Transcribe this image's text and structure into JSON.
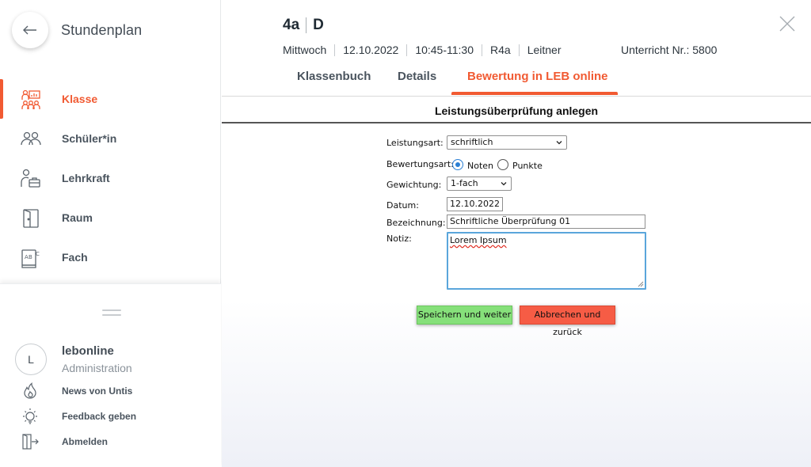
{
  "sidebar": {
    "title": "Stundenplan",
    "items": [
      {
        "label": "Klasse",
        "icon": "class-icon",
        "active": true
      },
      {
        "label": "Schüler*in",
        "icon": "students-icon",
        "active": false
      },
      {
        "label": "Lehrkraft",
        "icon": "teacher-icon",
        "active": false
      },
      {
        "label": "Raum",
        "icon": "door-icon",
        "active": false
      },
      {
        "label": "Fach",
        "icon": "subject-icon",
        "active": false
      }
    ],
    "user": {
      "initial": "L",
      "name": "lebonline",
      "role": "Administration"
    },
    "links": [
      {
        "label": "News von Untis",
        "icon": "flame-icon"
      },
      {
        "label": "Feedback geben",
        "icon": "lightbulb-icon"
      },
      {
        "label": "Abmelden",
        "icon": "logout-icon"
      }
    ]
  },
  "header": {
    "class": "4a",
    "subject": "D",
    "meta": [
      "Mittwoch",
      "12.10.2022",
      "10:45-11:30",
      "R4a",
      "Leitner"
    ],
    "unterricht": "Unterricht Nr.: 5800",
    "tabs": [
      {
        "label": "Klassenbuch",
        "active": false
      },
      {
        "label": "Details",
        "active": false
      },
      {
        "label": "Bewertung in LEB online",
        "active": true
      }
    ]
  },
  "form": {
    "title": "Leistungsüberprüfung anlegen",
    "leistungsart": {
      "label": "Leistungsart:",
      "value": "schriftlich"
    },
    "bewertungsart": {
      "label": "Bewertungsart:",
      "options": [
        "Noten",
        "Punkte"
      ],
      "selected": "Noten"
    },
    "gewichtung": {
      "label": "Gewichtung:",
      "value": "1-fach"
    },
    "datum": {
      "label": "Datum:",
      "value": "12.10.2022"
    },
    "bezeichnung": {
      "label": "Bezeichnung:",
      "value": "Schriftliche Überprüfung 01"
    },
    "notiz": {
      "label": "Notiz:",
      "value": "Lorem Ipsum"
    },
    "save_label": "Speichern und weiter",
    "cancel_label": "Abbrechen und zurück"
  },
  "colors": {
    "accent": "#f15a32",
    "save": "#86e07a",
    "cancel": "#f65c45",
    "focus": "#5aa6db"
  }
}
